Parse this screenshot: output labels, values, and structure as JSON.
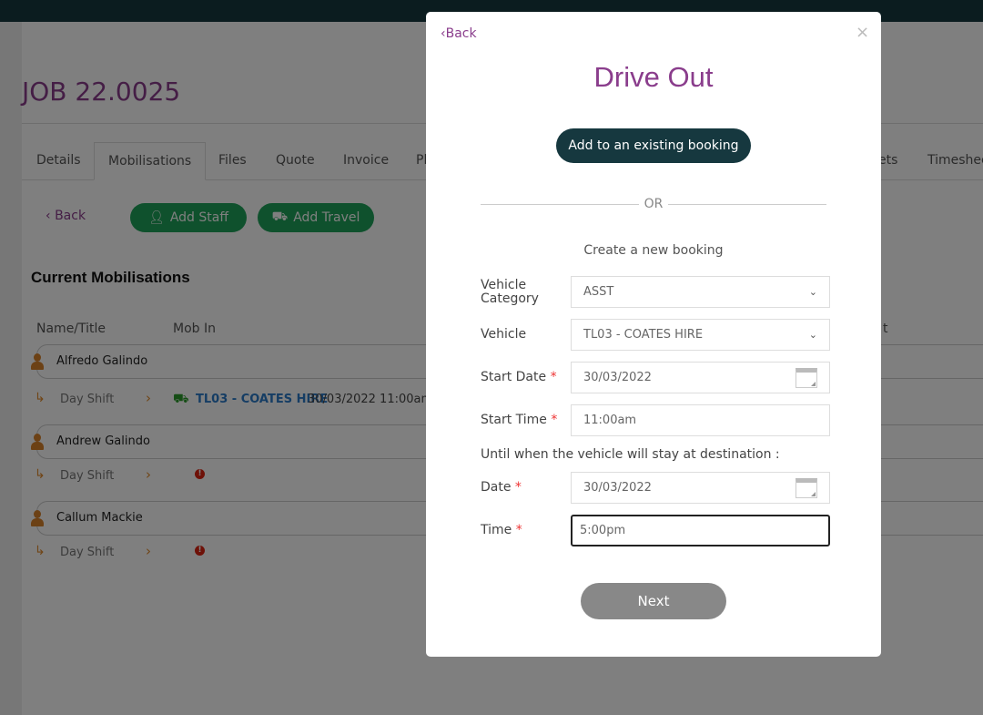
{
  "job": {
    "title": "JOB 22.0025"
  },
  "tabs": [
    {
      "label": "Details"
    },
    {
      "label": "Mobilisations",
      "active": true
    },
    {
      "label": "Files"
    },
    {
      "label": "Quote"
    },
    {
      "label": "Invoice"
    },
    {
      "label": "Pl"
    },
    {
      "label": "ets"
    },
    {
      "label": "Timeshee"
    }
  ],
  "toolbar": {
    "back": "Back",
    "add_staff": "Add Staff",
    "add_travel": "Add Travel"
  },
  "section_title": "Current Mobilisations",
  "columns": [
    "Name/Title",
    "Mob In",
    "t"
  ],
  "staff": [
    {
      "name": "Alfredo Galindo",
      "shift": "Day Shift",
      "vehicle": "TL03 - COATES HIRE",
      "vehicle_time": "30/03/2022 11:00am (",
      "status_icon": "truck-icon"
    },
    {
      "name": "Andrew Galindo",
      "shift": "Day Shift",
      "status_icon": "warning-icon"
    },
    {
      "name": "Callum Mackie",
      "shift": "Day Shift",
      "status_icon": "warning-icon"
    }
  ],
  "modal": {
    "back": "Back",
    "close": "×",
    "title": "Drive Out",
    "existing_booking": "Add to an existing booking",
    "or": "OR",
    "create_new": "Create a new booking",
    "fields": {
      "vehicle_category": {
        "label": "Vehicle Category",
        "value": "ASST"
      },
      "vehicle": {
        "label": "Vehicle",
        "value": "TL03 - COATES HIRE"
      },
      "start_date": {
        "label": "Start Date",
        "value": "30/03/2022"
      },
      "start_time": {
        "label": "Start Time",
        "value": "11:00am"
      },
      "until_note": "Until when the vehicle will stay at destination :",
      "date": {
        "label": "Date",
        "value": "30/03/2022"
      },
      "time": {
        "label": "Time",
        "value": "5:00pm"
      }
    },
    "required_mark": "*",
    "next": "Next"
  },
  "colors": {
    "brand_purple": "#8a3d8c",
    "dark_teal": "#16383f",
    "green": "#1fa35a",
    "link_blue": "#2a7ac9",
    "warning_red": "#dd2211"
  }
}
